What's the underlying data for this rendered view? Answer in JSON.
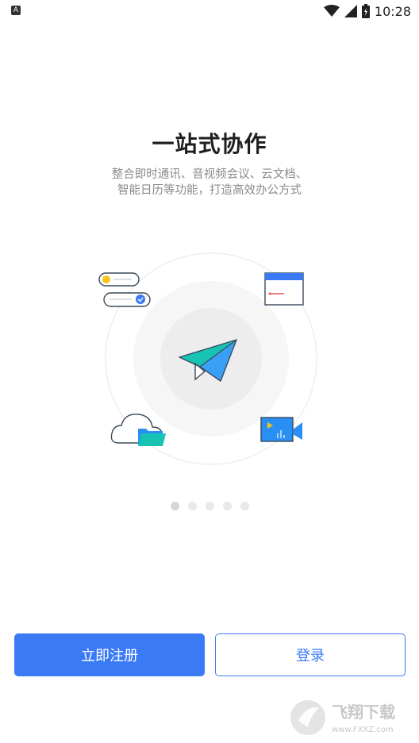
{
  "status_bar": {
    "time": "10:28",
    "left_icon": "A"
  },
  "onboarding": {
    "title": "一站式协作",
    "subtitle_line1": "整合即时通讯、音视频会议、云文档、",
    "subtitle_line2": "智能日历等功能，打造高效办公方式",
    "page_count": 5,
    "active_page": 1
  },
  "actions": {
    "register_label": "立即注册",
    "login_label": "登录"
  },
  "watermark": {
    "text": "飞翔下载",
    "url": "www.FXXZ.com"
  },
  "colors": {
    "primary": "#3b7af5",
    "plane_teal": "#17c3b2",
    "plane_blue": "#3aa0f5"
  },
  "icons": {
    "status_left": "keyboard-a-icon",
    "wifi": "wifi-icon",
    "signal": "signal-icon",
    "battery": "battery-icon",
    "plane": "paper-plane-icon",
    "chat": "chat-bubbles-icon",
    "calendar": "calendar-window-icon",
    "cloud": "cloud-folder-icon",
    "video": "video-camera-icon"
  }
}
